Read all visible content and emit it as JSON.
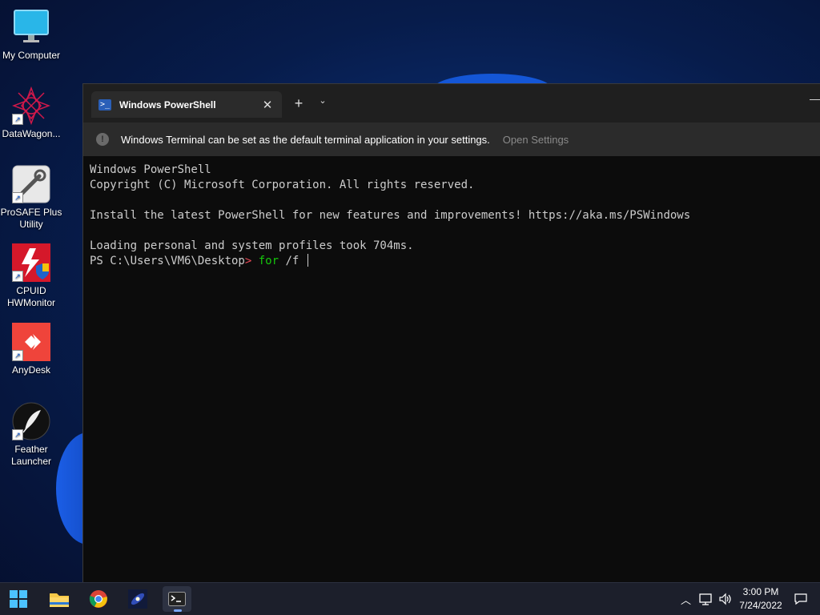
{
  "desktop": {
    "icons": [
      {
        "label": "My Computer",
        "icon": "monitor-icon"
      },
      {
        "label": "DataWagon...",
        "icon": "datawagon-icon"
      },
      {
        "label": "ProSAFE Plus Utility",
        "icon": "wrench-icon"
      },
      {
        "label": "CPUID HWMonitor",
        "icon": "hwmonitor-icon"
      },
      {
        "label": "AnyDesk",
        "icon": "anydesk-icon"
      },
      {
        "label": "Feather Launcher",
        "icon": "feather-icon"
      }
    ]
  },
  "terminal": {
    "tab_title": "Windows PowerShell",
    "info_message": "Windows Terminal can be set as the default terminal application in your settings.",
    "info_link": "Open Settings",
    "lines": [
      "Windows PowerShell",
      "Copyright (C) Microsoft Corporation. All rights reserved.",
      "",
      "Install the latest PowerShell for new features and improvements! https://aka.ms/PSWindows",
      "",
      "Loading personal and system profiles took 704ms."
    ],
    "prompt": "PS C:\\Users\\VM6\\Desktop",
    "prompt_arrow": ">",
    "command_keyword": "for",
    "command_args": "/f"
  },
  "taskbar": {
    "apps": [
      "start-icon",
      "file-explorer-icon",
      "chrome-icon",
      "galaxy-app-icon",
      "terminal-icon"
    ],
    "time": "3:00 PM",
    "date": "7/24/2022"
  },
  "colors": {
    "prompt_arrow": "#e74856",
    "keyword": "#16c60c",
    "console_bg": "#0c0c0c"
  }
}
